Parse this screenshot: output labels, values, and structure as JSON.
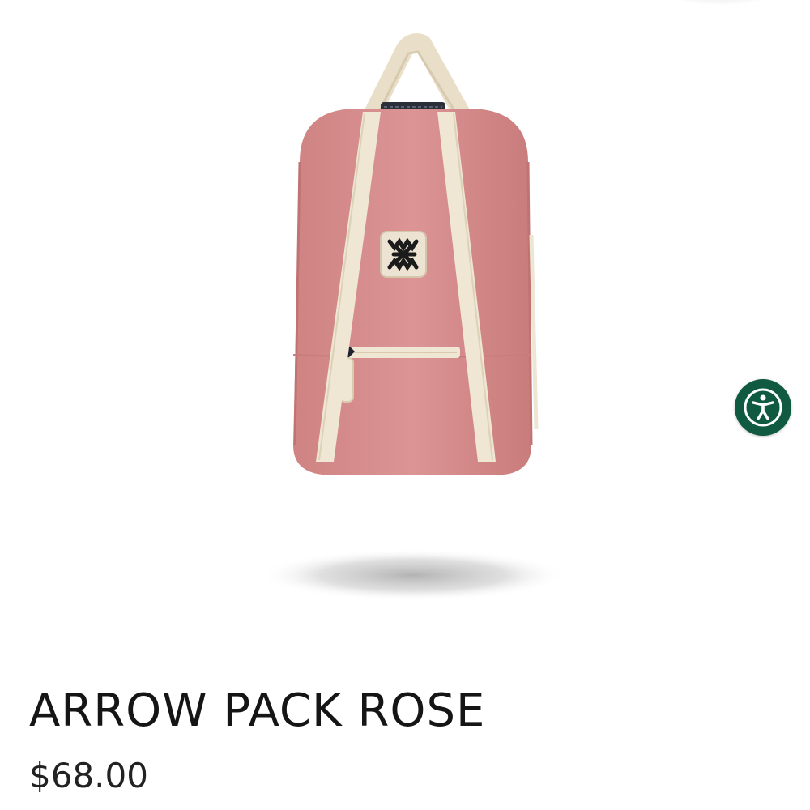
{
  "product": {
    "title": "ARROW PACK ROSE",
    "price": "$68.00",
    "image": {
      "subject": "backpack",
      "body_color": "#d98f8f",
      "strap_color": "#efe7d4",
      "logo_patch_color": "#ece3d2",
      "logo_mark_color": "#1b1b1b"
    }
  },
  "accessibility_widget": {
    "icon": "accessibility-icon",
    "background_color": "#0f5a40",
    "icon_color": "#ffffff"
  }
}
